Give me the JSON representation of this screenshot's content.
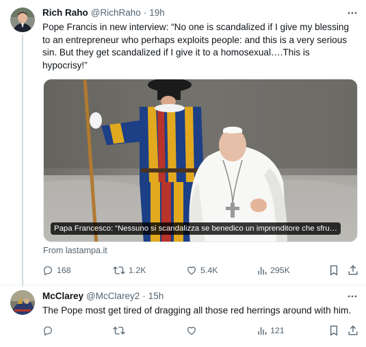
{
  "tweet1": {
    "name": "Rich Raho",
    "handle": "@RichRaho",
    "separator": "·",
    "time": "19h",
    "lines": [
      "Pope Francis in new interview: “No one is scandalized if I give my blessing",
      "to an entrepreneur who perhaps exploits people: and this is a very serious",
      "sin. But they get scandalized if I give it to a homosexual….This is",
      "hypocrisy!”"
    ],
    "media_caption": "Papa Francesco: “Nessuno si scandalizza se benedico un imprenditore che sfru…",
    "source": "From lastampa.it",
    "replies": "168",
    "reposts": "1.2K",
    "likes": "5.4K",
    "views": "295K"
  },
  "tweet2": {
    "name": "McClarey",
    "handle": "@McClarey2",
    "separator": "·",
    "time": "15h",
    "text": "The Pope most get tired of dragging all those red herrings around with him.",
    "views": "121"
  },
  "colors": {
    "text": "#0f1419",
    "secondary": "#536471",
    "thread_line": "#cfd9de"
  },
  "icons": [
    "more-icon",
    "reply-icon",
    "repost-icon",
    "like-icon",
    "views-icon",
    "bookmark-icon",
    "share-icon"
  ]
}
